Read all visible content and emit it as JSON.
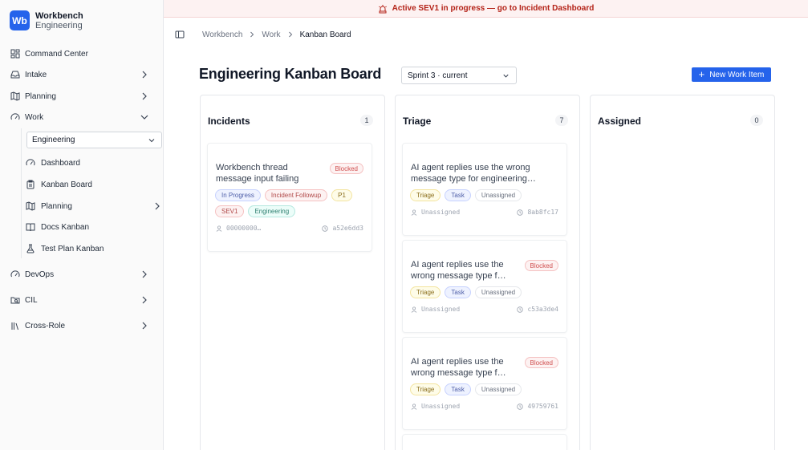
{
  "brand": {
    "logo": "Wb",
    "name": "Workbench",
    "team": "Engineering"
  },
  "banner": {
    "text": "Active SEV1 in progress — go to Incident Dashboard",
    "icon": "siren-icon",
    "color": "#b42318"
  },
  "sidebar": {
    "items": [
      {
        "label": "Command Center",
        "icon": "grid-icon"
      },
      {
        "label": "Intake",
        "icon": "inbox-icon"
      },
      {
        "label": "Planning",
        "icon": "map-icon"
      },
      {
        "label": "Work",
        "icon": "gauge-icon"
      },
      {
        "label": "DevOps",
        "icon": "gauge-icon"
      },
      {
        "label": "CIL",
        "icon": "folder-search-icon"
      },
      {
        "label": "Cross-Role",
        "icon": "library-icon"
      }
    ],
    "team_select": "Engineering",
    "work_sub": [
      {
        "label": "Dashboard",
        "icon": "gauge-icon"
      },
      {
        "label": "Kanban Board",
        "icon": "clipboard-icon"
      },
      {
        "label": "Planning",
        "icon": "map-icon"
      },
      {
        "label": "Docs Kanban",
        "icon": "book-icon"
      },
      {
        "label": "Test Plan Kanban",
        "icon": "flask-icon"
      }
    ]
  },
  "breadcrumb": [
    "Workbench",
    "Work",
    "Kanban Board"
  ],
  "header": {
    "title": "Engineering Kanban Board",
    "sprint": "Sprint 3 · current",
    "new_button": "New Work Item",
    "accent": "#2563eb"
  },
  "columns": [
    {
      "title": "Incidents",
      "count": "1",
      "cards": [
        {
          "title_l1": "Workbench thread",
          "title_l2": "message input failing",
          "status": "Blocked",
          "tags": [
            "In Progress",
            "Incident Followup",
            "P1",
            "SEV1",
            "Engineering"
          ],
          "assignee": "00000000…",
          "id": "a52e6dd3"
        }
      ]
    },
    {
      "title": "Triage",
      "count": "7",
      "cards": [
        {
          "title_l1": "AI agent replies use the wrong",
          "title_l2": "message type for engineering…",
          "status": "",
          "tags": [
            "Triage",
            "Task",
            "Unassigned"
          ],
          "assignee": "Unassigned",
          "id": "8ab8fc17"
        },
        {
          "title_l1": "AI agent replies use the",
          "title_l2": "wrong message type f…",
          "status": "Blocked",
          "tags": [
            "Triage",
            "Task",
            "Unassigned"
          ],
          "assignee": "Unassigned",
          "id": "c53a3de4"
        },
        {
          "title_l1": "AI agent replies use the",
          "title_l2": "wrong message type f…",
          "status": "Blocked",
          "tags": [
            "Triage",
            "Task",
            "Unassigned"
          ],
          "assignee": "Unassigned",
          "id": "49759761"
        }
      ]
    },
    {
      "title": "Assigned",
      "count": "0",
      "cards": []
    }
  ]
}
